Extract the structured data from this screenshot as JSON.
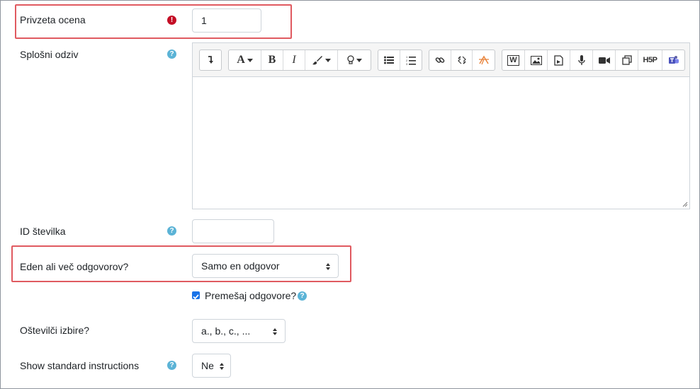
{
  "fields": {
    "grade": {
      "label": "Privzeta ocena",
      "value": "1"
    },
    "feedback": {
      "label": "Splošni odziv"
    },
    "idnumber": {
      "label": "ID številka",
      "value": ""
    },
    "single": {
      "label": "Eden ali več odgovorov?",
      "value": "Samo en odgovor"
    },
    "shuffle": {
      "label": "Premešaj odgovore?",
      "checked": true
    },
    "numbering": {
      "label": "Oštevilči izbire?",
      "value": "a., b., c., ..."
    },
    "instructions": {
      "label": "Show standard instructions",
      "value": "Ne"
    }
  },
  "toolbar": {
    "font_letter": "A",
    "bold": "B",
    "italic": "I",
    "word": "W",
    "h5p": "H5P"
  },
  "icons": {
    "required": "exclamation-icon",
    "help": "question-icon"
  },
  "colors": {
    "accent": "#1a73e8",
    "help": "#5bb3d6",
    "required": "#c40e25",
    "highlight": "#e05a60"
  }
}
